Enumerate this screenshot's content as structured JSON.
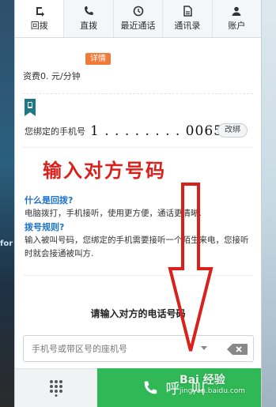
{
  "background": {
    "side_text": "for"
  },
  "tabs": [
    {
      "label": "回拨",
      "icon": "callback-icon",
      "active": true
    },
    {
      "label": "直拨",
      "icon": "phone-icon",
      "active": false
    },
    {
      "label": "最近通话",
      "icon": "history-icon",
      "active": false
    },
    {
      "label": "通讯录",
      "icon": "contacts-icon",
      "active": false
    },
    {
      "label": "账户",
      "icon": "account-icon",
      "active": false
    }
  ],
  "fee": {
    "text": "资费0.  元/分钟",
    "detail_label": "详情"
  },
  "binding": {
    "label": "您绑定的手机号",
    "number": "1 . . . . . . . . 00653",
    "unbind_label": "改绑"
  },
  "annotation": {
    "title": "输入对方号码",
    "color": "#d9201a"
  },
  "info": {
    "q1": "什么是回拨?",
    "a1": "电脑拨打，手机接听，使用更方便，通话更清晰.",
    "q2": "拨号规则?",
    "a2": "输入被叫号码，您绑定的手机需要接听一个陌生来电，您接听时就会接通被叫方."
  },
  "dial": {
    "prompt": "请输入对方的电话号码",
    "placeholder": "手机号或带区号的座机号",
    "call_label": "呼叫"
  },
  "watermark": {
    "brand": "Bai 经验",
    "url": "jingyan.baidu.com"
  },
  "colors": {
    "accent_green": "#2fb855",
    "question_blue": "#1e73c8",
    "badge_orange": "#f07a3a",
    "icon_teal": "#1c7a86"
  }
}
